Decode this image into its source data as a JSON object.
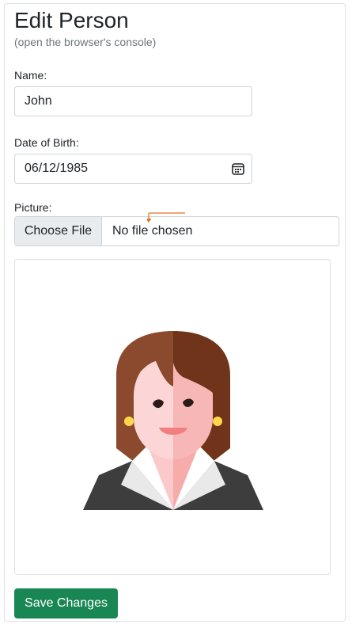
{
  "form": {
    "title": "Edit Person",
    "subtitle": "(open the browser's console)",
    "name_label": "Name:",
    "name_value": "John",
    "dob_label": "Date of Birth:",
    "dob_value": "06/12/1985",
    "picture_label": "Picture:",
    "file_button": "Choose File",
    "file_status": "No file chosen",
    "save_button": "Save Changes"
  },
  "icons": {
    "date_picker": "calendar-icon",
    "picture": "person-avatar-illustration"
  },
  "colors": {
    "save_button": "#198754",
    "file_button_bg": "#e9ecef",
    "border": "#ced4da",
    "muted_text": "#6c757d",
    "cursor_marker": "#e8711a"
  }
}
